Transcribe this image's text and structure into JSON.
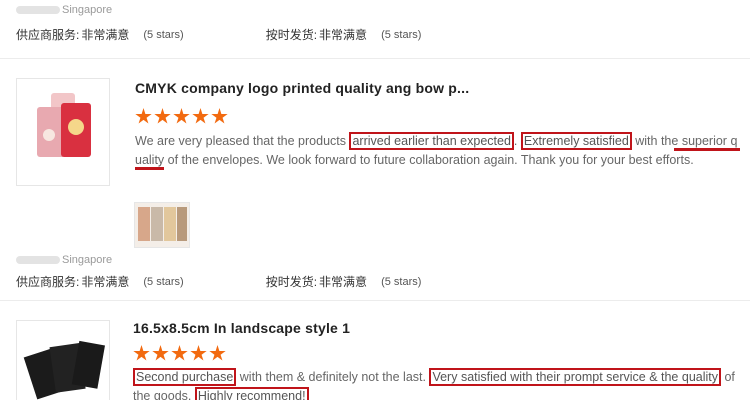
{
  "review1": {
    "location": "Singapore",
    "supplier_service_label": "供应商服务:",
    "supplier_service_value": "非常满意",
    "supplier_service_stars": "(5 stars)",
    "shipping_label": "按时发货:",
    "shipping_value": "非常满意",
    "shipping_stars": "(5 stars)"
  },
  "review2": {
    "title": "CMYK company logo printed quality ang bow p...",
    "rating": 5,
    "text_1": "We are very pleased that the products ",
    "text_2": "arrived earlier than expected",
    "text_3": ". ",
    "text_4": "Extremely satisfied",
    "text_5": " with the ",
    "text_6": "superior q",
    "text_7": "uality",
    "text_8": " of the envelopes. We look forward to future collaboration again. Thank you for your best efforts.",
    "location": "Singapore",
    "supplier_service_label": "供应商服务:",
    "supplier_service_value": "非常满意",
    "supplier_service_stars": "(5 stars)",
    "shipping_label": "按时发货:",
    "shipping_value": "非常满意",
    "shipping_stars": "(5 stars)"
  },
  "review3": {
    "title": "16.5x8.5cm In landscape style 1",
    "rating": 5,
    "text_1": "Second purchase",
    "text_2": " with them & definitely not the last. ",
    "text_3": "Very satisfied with their prompt service & the quality",
    "text_4": " of",
    "text_5": "the goods. ",
    "text_6": "Highly recommend!"
  },
  "colors": {
    "star": "#f26a10",
    "highlight": "#c0141a"
  }
}
